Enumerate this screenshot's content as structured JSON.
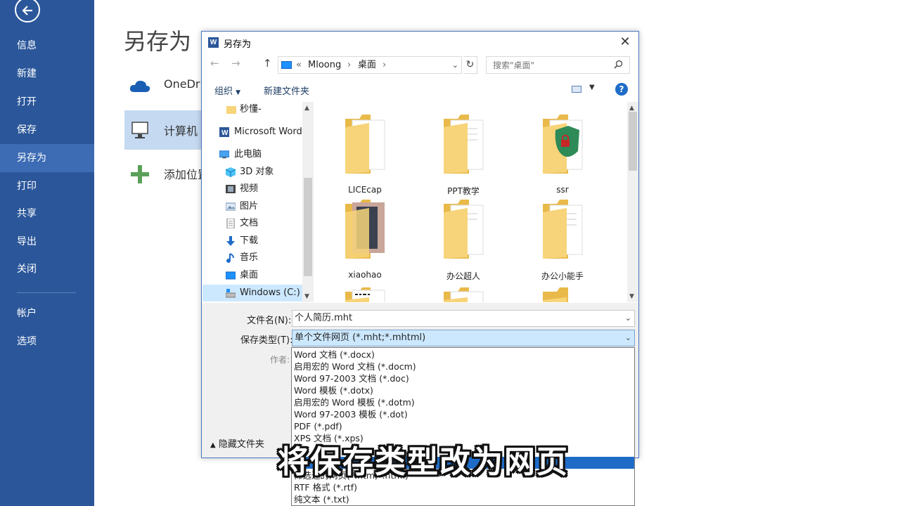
{
  "sidebar": {
    "items": [
      {
        "id": "info",
        "label": "信息"
      },
      {
        "id": "new",
        "label": "新建"
      },
      {
        "id": "open",
        "label": "打开"
      },
      {
        "id": "save",
        "label": "保存"
      },
      {
        "id": "saveas",
        "label": "另存为",
        "active": true
      },
      {
        "id": "print",
        "label": "打印"
      },
      {
        "id": "share",
        "label": "共享"
      },
      {
        "id": "export",
        "label": "导出"
      },
      {
        "id": "close",
        "label": "关闭"
      }
    ],
    "bottom_items": [
      {
        "id": "account",
        "label": "帐户"
      },
      {
        "id": "options",
        "label": "选项"
      }
    ]
  },
  "main": {
    "title": "另存为",
    "places": [
      {
        "id": "onedrive",
        "label": "OneDri"
      },
      {
        "id": "computer",
        "label": "计算机"
      },
      {
        "id": "add",
        "label": "添加位置"
      }
    ]
  },
  "dialog": {
    "title": "另存为",
    "address": {
      "prefix": "«",
      "crumbs": [
        "Mloong",
        "桌面"
      ]
    },
    "search_placeholder": "搜索\"桌面\"",
    "toolbar": {
      "organize": "组织",
      "new_folder": "新建文件夹"
    },
    "tree": [
      {
        "label": "秒懂-",
        "icon": "folder"
      },
      {
        "label": "Microsoft Word",
        "icon": "word"
      },
      {
        "label": "此电脑",
        "icon": "pc"
      },
      {
        "label": "3D 对象",
        "icon": "cube"
      },
      {
        "label": "视频",
        "icon": "video"
      },
      {
        "label": "图片",
        "icon": "picture"
      },
      {
        "label": "文档",
        "icon": "document"
      },
      {
        "label": "下载",
        "icon": "download"
      },
      {
        "label": "音乐",
        "icon": "music"
      },
      {
        "label": "桌面",
        "icon": "desktop"
      },
      {
        "label": "Windows (C:)",
        "icon": "drive",
        "selected": true
      }
    ],
    "files": [
      {
        "name": "LICEcap"
      },
      {
        "name": "PPT教学"
      },
      {
        "name": "ssr"
      },
      {
        "name": "xiaohao"
      },
      {
        "name": "办公超人"
      },
      {
        "name": "办公小能手"
      }
    ],
    "form": {
      "filename_label": "文件名(N):",
      "filename_value": "个人简历.mht",
      "filetype_label": "保存类型(T):",
      "filetype_value": "单个文件网页 (*.mht;*.mhtml)",
      "author_label": "作者:",
      "hide_folders": "隐藏文件夹"
    },
    "type_options": [
      "Word 文档 (*.docx)",
      "启用宏的 Word 文档 (*.docm)",
      "Word 97-2003 文档 (*.doc)",
      "Word 模板 (*.dotx)",
      "启用宏的 Word 模板 (*.dotm)",
      "Word 97-2003 模板 (*.dot)",
      "PDF (*.pdf)",
      "XPS 文档 (*.xps)",
      "",
      "",
      "筛选过的网页(*.htm;*.html)",
      "RTF 格式 (*.rtf)",
      "纯文本 (*.txt)"
    ]
  },
  "subtitle": "将保存类型改为网页",
  "colors": {
    "sidebar": "#2b579a",
    "sidebar_active": "#3d6cb4",
    "accent": "#1e6cc8",
    "folder": "#f7d479"
  }
}
